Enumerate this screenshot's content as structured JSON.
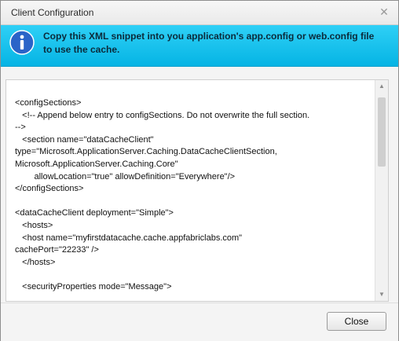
{
  "dialog": {
    "title": "Client Configuration",
    "close_glyph": "✕",
    "icons": {
      "close": "close-icon",
      "info": "info-icon"
    }
  },
  "banner": {
    "message": "Copy this XML snippet into you application's app.config or web.config file to use the cache.",
    "accent": "#12C2EE"
  },
  "code": {
    "lines": [
      "<configSections>",
      "   <!-- Append below entry to configSections. Do not overwrite the full section.",
      "-->",
      "   <section name=\"dataCacheClient\"",
      "type=\"Microsoft.ApplicationServer.Caching.DataCacheClientSection,",
      "Microsoft.ApplicationServer.Caching.Core\"",
      "        allowLocation=\"true\" allowDefinition=\"Everywhere\"/>",
      "</configSections>",
      "",
      "<dataCacheClient deployment=\"Simple\">",
      "   <hosts>",
      "   <host name=\"myfirstdatacache.cache.appfabriclabs.com\"",
      "cachePort=\"22233\" />",
      "   </hosts>",
      "",
      "   <securityProperties mode=\"Message\">"
    ]
  },
  "scrollbar": {
    "up_glyph": "▲",
    "down_glyph": "▼",
    "icons": {
      "up": "scroll-up-arrow-icon",
      "down": "scroll-down-arrow-icon"
    }
  },
  "footer": {
    "close_label": "Close"
  }
}
